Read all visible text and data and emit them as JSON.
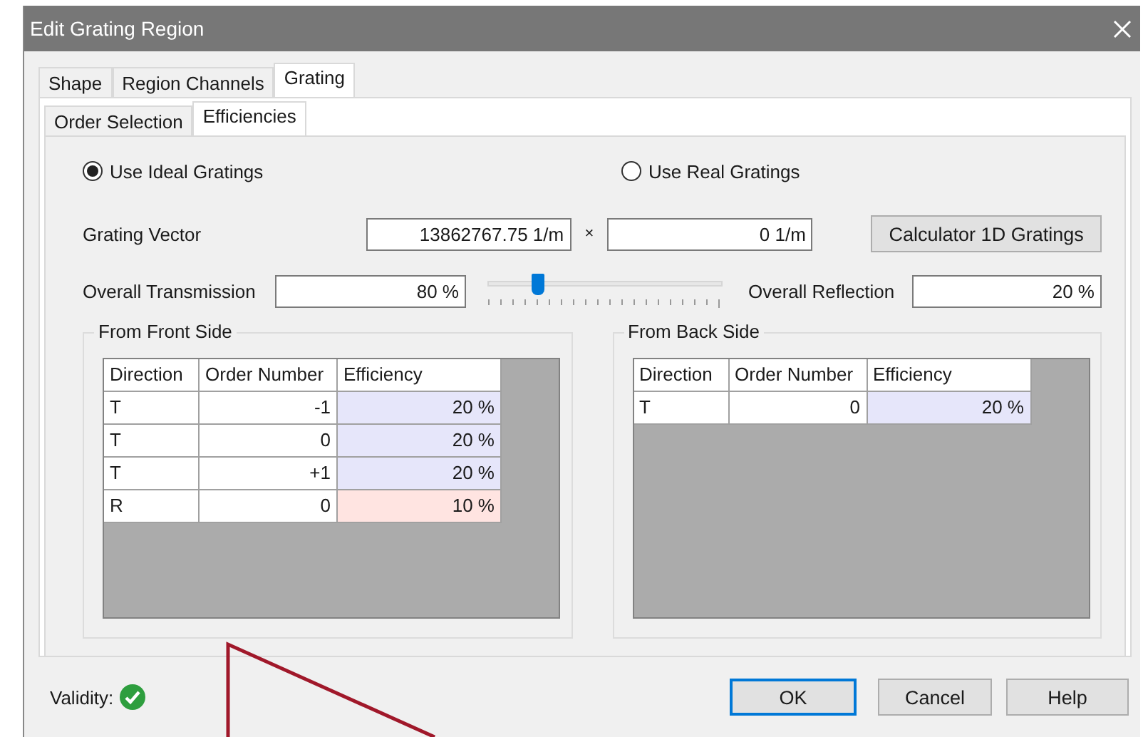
{
  "window": {
    "title": "Edit Grating Region"
  },
  "tabs": [
    {
      "label": "Shape",
      "selected": false
    },
    {
      "label": "Region Channels",
      "selected": false
    },
    {
      "label": "Grating",
      "selected": true
    }
  ],
  "subtabs": [
    {
      "label": "Order Selection",
      "selected": false
    },
    {
      "label": "Efficiencies",
      "selected": true
    }
  ],
  "mode": [
    {
      "label": "Use Ideal Gratings",
      "selected": true
    },
    {
      "label": "Use Real Gratings",
      "selected": false
    }
  ],
  "grating_vector": {
    "label": "Grating Vector",
    "x": "13862767.75 1/m",
    "separator": "×",
    "y": "0 1/m",
    "button": "Calculator 1D Gratings"
  },
  "transmission": {
    "label": "Overall Transmission",
    "value": "80 %",
    "level": 0.2
  },
  "reflection": {
    "label": "Overall Reflection",
    "value": "20 %"
  },
  "front": {
    "title": "From Front Side",
    "columns": [
      "Direction",
      "Order Number",
      "Efficiency"
    ],
    "rows": [
      {
        "direction": "T",
        "order": "-1",
        "efficiency": "20 %",
        "color": "#e6e6fa"
      },
      {
        "direction": "T",
        "order": "0",
        "efficiency": "20 %",
        "color": "#e6e6fa"
      },
      {
        "direction": "T",
        "order": "+1",
        "efficiency": "20 %",
        "color": "#e6e6fa"
      },
      {
        "direction": "R",
        "order": "0",
        "efficiency": "10 %",
        "color": "#ffe4e1"
      }
    ]
  },
  "back": {
    "title": "From Back Side",
    "columns": [
      "Direction",
      "Order Number",
      "Efficiency"
    ],
    "rows": [
      {
        "direction": "T",
        "order": "0",
        "efficiency": "20 %",
        "color": "#e6e6fa"
      }
    ]
  },
  "validity": {
    "label": "Validity:",
    "valid": true
  },
  "buttons": [
    {
      "label": "OK",
      "default": true
    },
    {
      "label": "Cancel",
      "default": false
    },
    {
      "label": "Help",
      "default": false
    }
  ]
}
